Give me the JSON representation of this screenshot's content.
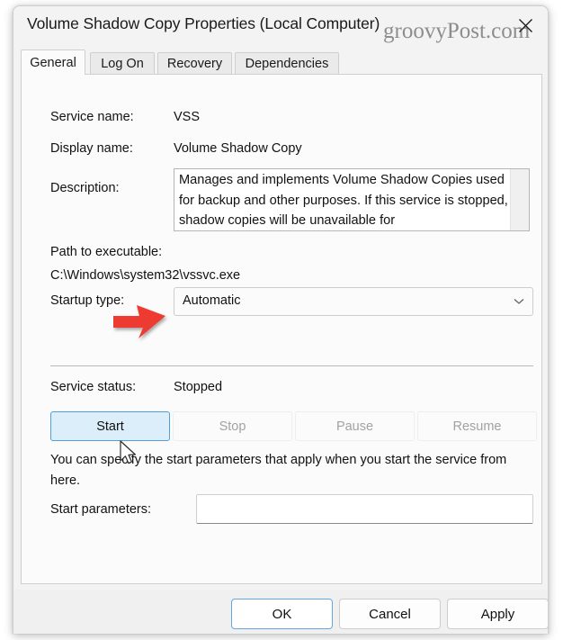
{
  "window": {
    "title": "Volume Shadow Copy Properties (Local Computer)",
    "watermark": "groovyPost.com",
    "close_label": "Close"
  },
  "tabs": [
    {
      "label": "General",
      "active": true
    },
    {
      "label": "Log On",
      "active": false
    },
    {
      "label": "Recovery",
      "active": false
    },
    {
      "label": "Dependencies",
      "active": false
    }
  ],
  "general": {
    "service_name_label": "Service name:",
    "service_name_value": "VSS",
    "display_name_label": "Display name:",
    "display_name_value": "Volume Shadow Copy",
    "description_label": "Description:",
    "description_value": "Manages and implements Volume Shadow Copies used for backup and other purposes. If this service is stopped, shadow copies will be unavailable for",
    "path_label": "Path to executable:",
    "path_value": "C:\\Windows\\system32\\vssvc.exe",
    "startup_type_label": "Startup type:",
    "startup_type_value": "Automatic",
    "service_status_label": "Service status:",
    "service_status_value": "Stopped",
    "helper_text": "You can specify the start parameters that apply when you start the service from here.",
    "start_parameters_label": "Start parameters:",
    "start_parameters_value": ""
  },
  "action_buttons": [
    {
      "label": "Start",
      "enabled": true
    },
    {
      "label": "Stop",
      "enabled": false
    },
    {
      "label": "Pause",
      "enabled": false
    },
    {
      "label": "Resume",
      "enabled": false
    }
  ],
  "dialog_buttons": [
    {
      "label": "OK",
      "default": true
    },
    {
      "label": "Cancel",
      "default": false
    },
    {
      "label": "Apply",
      "default": false
    }
  ],
  "colors": {
    "accent": "#4f9fdb",
    "annotation_arrow": "#ee3b33",
    "window_bg": "#f3f3f3",
    "panel_bg": "#fbfbfb",
    "footer_bg": "#f0f0f0"
  }
}
